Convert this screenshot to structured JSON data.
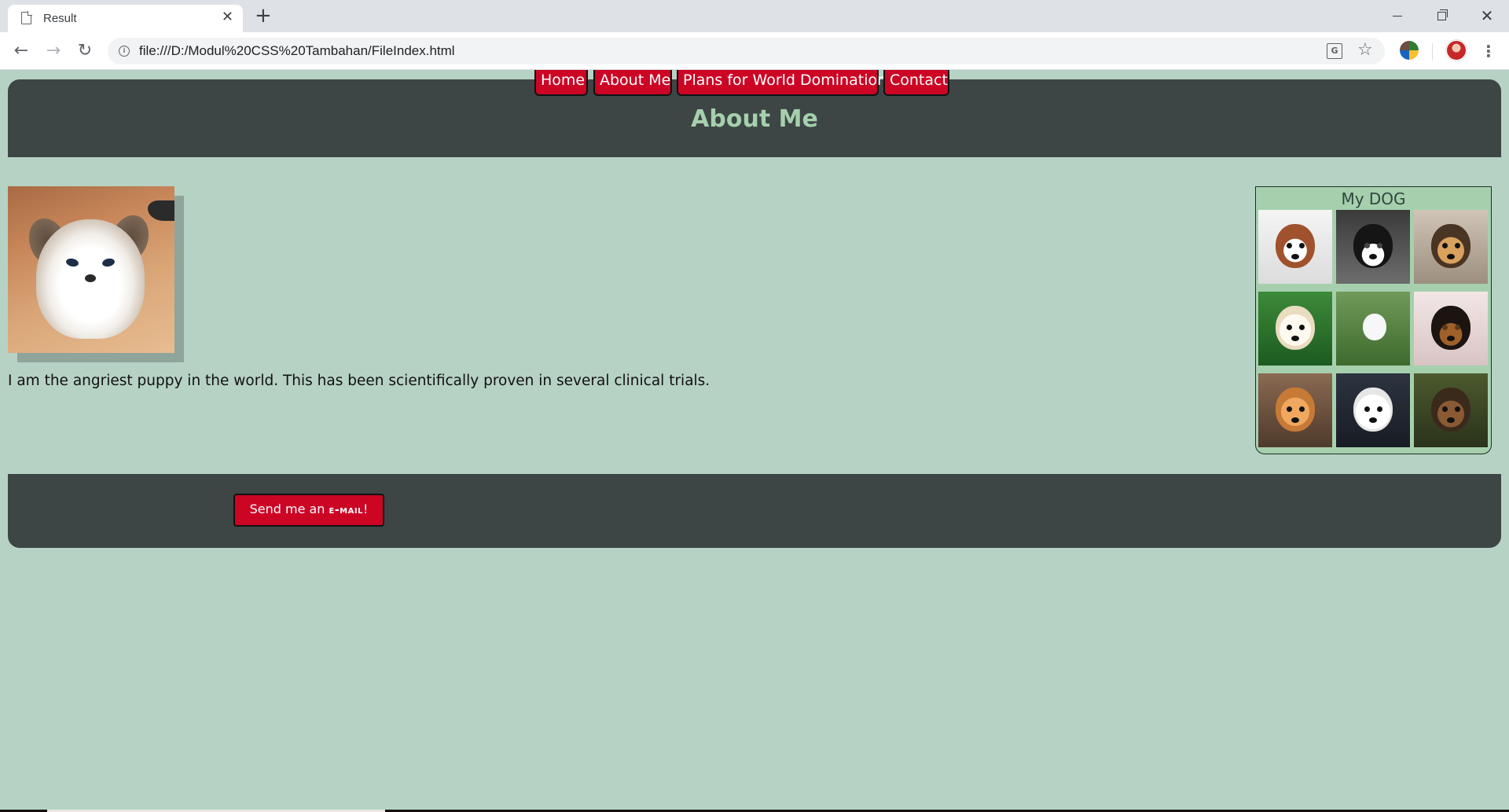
{
  "browser": {
    "tab_title": "Result",
    "tab_close": "✕",
    "new_tab": "+",
    "url": "file:///D:/Modul%20CSS%20Tambahan/FileIndex.html",
    "info_glyph": "i",
    "translate_glyph": "G",
    "star_glyph": "☆",
    "back_glyph": "←",
    "forward_glyph": "→",
    "reload_glyph": "↻",
    "menu_glyph": "⋮",
    "close_glyph": "✕",
    "icons": [
      "page-icon",
      "close-icon",
      "plus-icon",
      "back-arrow-icon",
      "forward-arrow-icon",
      "reload-icon",
      "info-icon",
      "translate-icon",
      "star-icon",
      "extension-icon",
      "avatar",
      "menu-icon",
      "minimize-icon",
      "maximize-icon"
    ]
  },
  "nav": {
    "items": [
      {
        "label": "Home"
      },
      {
        "label": "About Me"
      },
      {
        "label": "Plans for World Domination"
      },
      {
        "label": "Contact"
      }
    ]
  },
  "header": {
    "title": "About Me"
  },
  "main": {
    "bio": "I am the angriest puppy in the world. This has been scientifically proven in several clinical trials."
  },
  "gallery": {
    "title": "My DOG",
    "thumbnails": [
      "puppy-1",
      "puppy-2",
      "puppy-3",
      "puppy-4",
      "puppy-5",
      "puppy-6",
      "puppy-7",
      "puppy-8",
      "puppy-9"
    ]
  },
  "footer": {
    "email_prefix": "Send me an ",
    "email_word": "e-mail",
    "email_suffix": "!"
  },
  "colors": {
    "page_background": "#b6d2c4",
    "panel_dark": "#3d4545",
    "heading_green": "#a6d0ad",
    "button_red": "#cc0525",
    "gallery_bg": "#a6d0ad"
  }
}
